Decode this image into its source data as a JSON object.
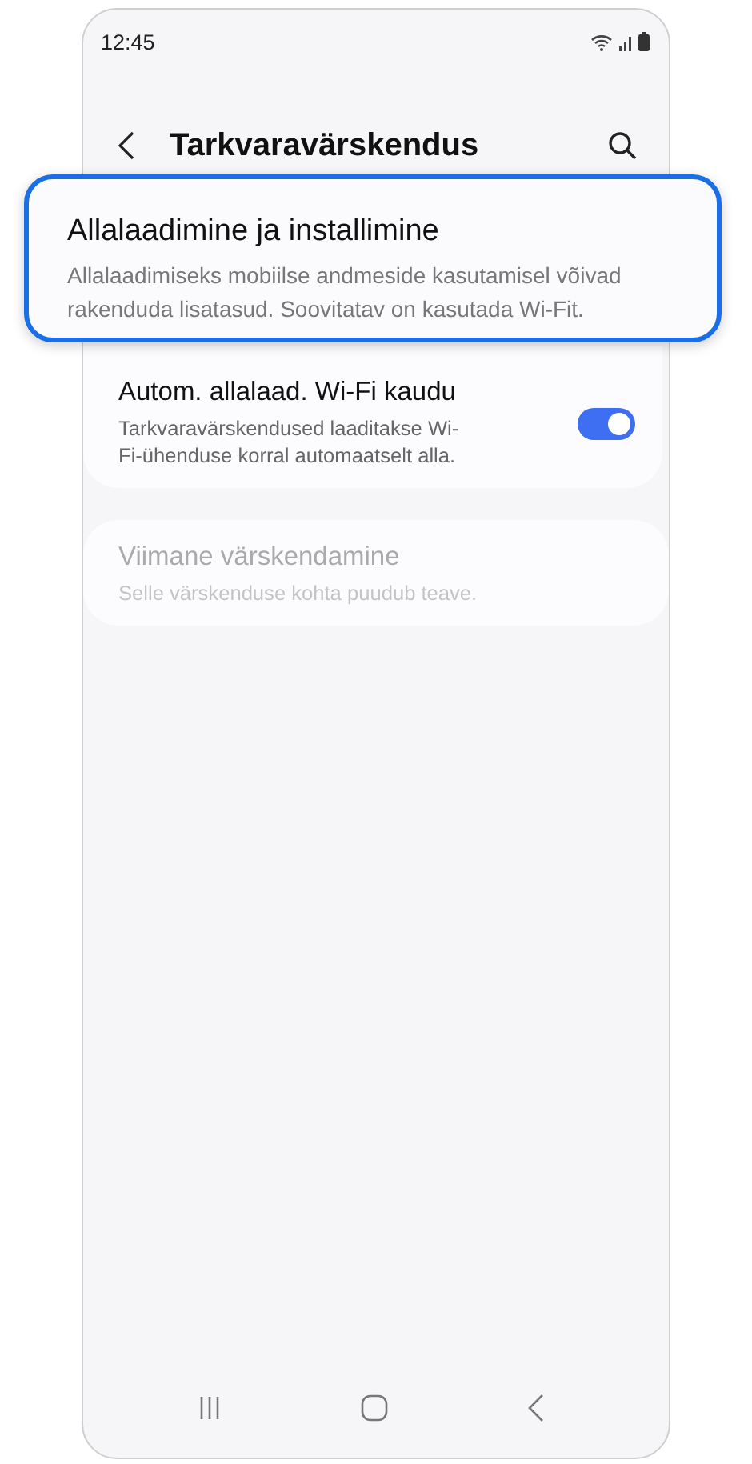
{
  "status_bar": {
    "time": "12:45"
  },
  "header": {
    "title": "Tarkvaravärskendus"
  },
  "callout": {
    "title": "Allalaadimine ja installimine",
    "description": "Allalaadimiseks mobiilse andmeside kasutamisel võivad rakenduda lisatasud. Soovitatav on kasutada Wi-Fit."
  },
  "settings": [
    {
      "kind": "toggle",
      "title": "Autom. allalaad. Wi-Fi kaudu",
      "description": "Tarkvaravärskendused laaditakse Wi-Fi-ühenduse korral automaatselt alla.",
      "on": true,
      "disabled": false
    },
    {
      "kind": "info",
      "title": "Viimane värskendamine",
      "description": "Selle värskenduse kohta puudub teave.",
      "disabled": true
    }
  ]
}
